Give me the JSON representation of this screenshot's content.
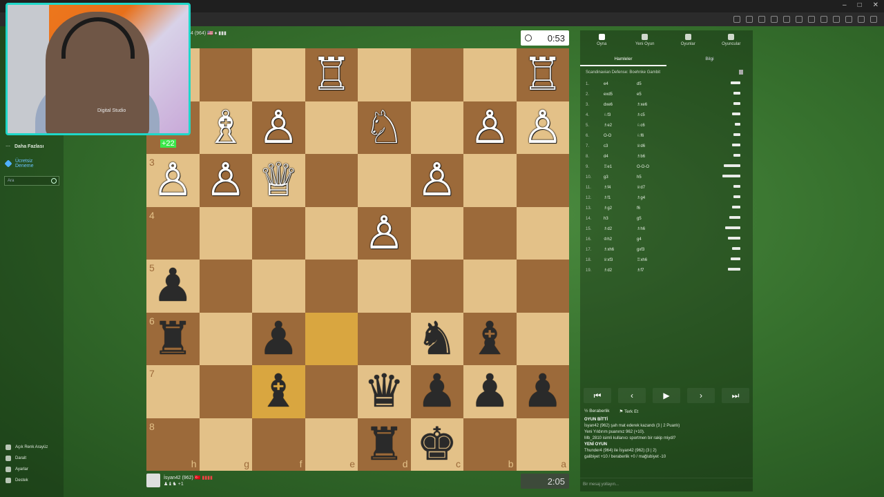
{
  "window": {
    "controls": [
      "–",
      "□",
      "✕"
    ]
  },
  "webcam": {
    "shirt_text": "Digital Studio"
  },
  "leftnav": {
    "more_label": "Daha Fazlası",
    "trial_label_1": "Ücretsiz",
    "trial_label_2": "Deneme",
    "search_placeholder": "Ara",
    "light_theme": "Açık Renk Arayüz",
    "collapse": "Daralt",
    "settings": "Ayarlar",
    "support": "Destek"
  },
  "opponent": {
    "info": "4 (964) 🇺🇸 ♦ ▮▮▮",
    "clock": "0:53",
    "captured": "+22"
  },
  "me": {
    "name": "İsyan42 (962)",
    "flag": "🇹🇷 ▮▮▮▮",
    "material": "♟♝♞ +1",
    "clock": "2:05"
  },
  "board": {
    "rank_labels": [
      "",
      "",
      "3",
      "4",
      "5",
      "6",
      "7",
      "8"
    ],
    "file_labels": [
      "h",
      "g",
      "f",
      "e",
      "d",
      "c",
      "b",
      "a"
    ],
    "rows": [
      [
        "",
        "",
        "",
        "wR",
        "",
        "",
        "",
        "wR"
      ],
      [
        "",
        "wB",
        "wP",
        "",
        "wN",
        "",
        "wP",
        "wP"
      ],
      [
        "wP",
        "wP",
        "wQ",
        "",
        "",
        "wP",
        "",
        ""
      ],
      [
        "",
        "",
        "",
        "",
        "wP",
        "",
        "",
        ""
      ],
      [
        "bP",
        "",
        "",
        "",
        "",
        "",
        "",
        ""
      ],
      [
        "bR",
        "",
        "bP",
        "",
        "",
        "bN",
        "bB",
        ""
      ],
      [
        "",
        "",
        "bB",
        "",
        "bQ",
        "bP",
        "bP",
        "bP"
      ],
      [
        "",
        "",
        "",
        "",
        "bR",
        "bK",
        "",
        ""
      ]
    ],
    "highlight": [
      [
        5,
        3
      ],
      [
        6,
        2
      ]
    ]
  },
  "panel": {
    "tabs": [
      "Oyna",
      "Yeni Oyun",
      "Oyunlar",
      "Oyuncular"
    ],
    "subtabs": [
      "Hamleler",
      "Bilgi"
    ],
    "opening": "Scandinavian Defense: Boehnke Gambit",
    "moves": [
      {
        "n": "1.",
        "w": "e4",
        "b": "d5"
      },
      {
        "n": "2.",
        "w": "exd5",
        "b": "e5"
      },
      {
        "n": "3.",
        "w": "dxe6",
        "b": "♗xe6"
      },
      {
        "n": "4.",
        "w": "♘f3",
        "b": "♗c5"
      },
      {
        "n": "5.",
        "w": "♗e2",
        "b": "♘c6"
      },
      {
        "n": "6.",
        "w": "O-O",
        "b": "♘f6"
      },
      {
        "n": "7.",
        "w": "c3",
        "b": "♕d6"
      },
      {
        "n": "8.",
        "w": "d4",
        "b": "♗b6"
      },
      {
        "n": "9.",
        "w": "♖e1",
        "b": "O-O-O"
      },
      {
        "n": "10.",
        "w": "g3",
        "b": "h5"
      },
      {
        "n": "11.",
        "w": "♗f4",
        "b": "♕d7"
      },
      {
        "n": "12.",
        "w": "♗f1",
        "b": "♗g4"
      },
      {
        "n": "13.",
        "w": "♗g2",
        "b": "f6"
      },
      {
        "n": "14.",
        "w": "h3",
        "b": "g5"
      },
      {
        "n": "15.",
        "w": "♗d2",
        "b": "♗h6"
      },
      {
        "n": "16.",
        "w": "♔h2",
        "b": "g4"
      },
      {
        "n": "17.",
        "w": "♗xh6",
        "b": "gxf3"
      },
      {
        "n": "18.",
        "w": "♕xf3",
        "b": "♖xh6"
      },
      {
        "n": "19.",
        "w": "♗d2",
        "b": "♗f7"
      }
    ],
    "nav": [
      "⏮",
      "‹",
      "▶",
      "›",
      "⏭"
    ],
    "draw": "Beraberlik",
    "resign": "Terk Et",
    "chat": [
      {
        "text": "OYUN BİTTİ",
        "head": true
      },
      {
        "text": "İsyan42 (962) şah mat ederek kazandı (3 | 2 Puanlı)",
        "head": false
      },
      {
        "text": "Yeni Yıldırım puanınız 962 (+10).",
        "head": false
      },
      {
        "text": "Mb_2810 isimli kullanıcı sportmen bir rakip miydi?",
        "head": false
      },
      {
        "text": "YENİ OYUN",
        "head": true
      },
      {
        "text": "Thunder4 (964) ile İsyan42 (962) (3 | 2)",
        "head": false
      },
      {
        "text": "galibiyet +10 / beraberlik +0 / mağlubiyet -10",
        "head": false
      }
    ],
    "chat_placeholder": "Bir mesaj yollayın..."
  }
}
